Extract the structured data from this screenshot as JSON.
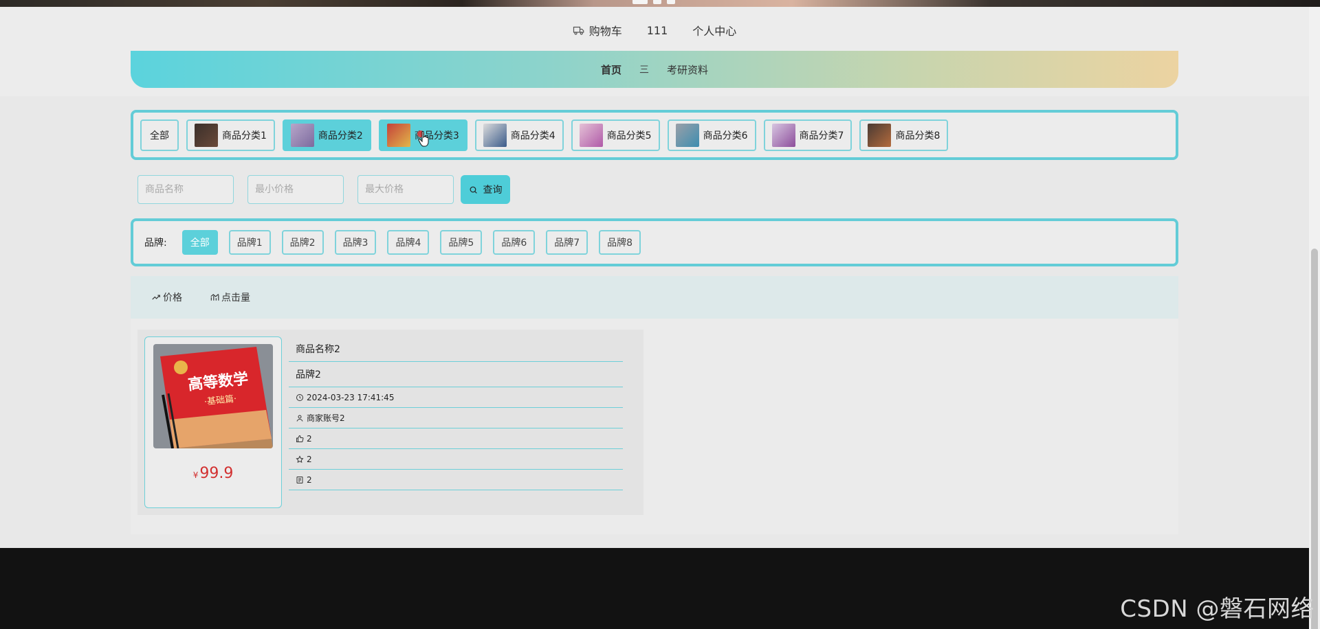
{
  "topnav": {
    "cart_label": "购物车",
    "user_name": "111",
    "profile_label": "个人中心"
  },
  "menubar": {
    "home_label": "首页",
    "separator": "三",
    "link_label": "考研资料"
  },
  "categories": {
    "all_label": "全部",
    "items": [
      {
        "label": "商品分类1",
        "active": false
      },
      {
        "label": "商品分类2",
        "active": true
      },
      {
        "label": "商品分类3",
        "active": true
      },
      {
        "label": "商品分类4",
        "active": false
      },
      {
        "label": "商品分类5",
        "active": false
      },
      {
        "label": "商品分类6",
        "active": false
      },
      {
        "label": "商品分类7",
        "active": false
      },
      {
        "label": "商品分类8",
        "active": false
      }
    ]
  },
  "search": {
    "name_placeholder": "商品名称",
    "min_price_placeholder": "最小价格",
    "max_price_placeholder": "最大价格",
    "button_label": "查询"
  },
  "brands": {
    "label": "品牌:",
    "all_label": "全部",
    "items": [
      "品牌1",
      "品牌2",
      "品牌3",
      "品牌4",
      "品牌5",
      "品牌6",
      "品牌7",
      "品牌8"
    ]
  },
  "sort": {
    "price_label": "价格",
    "clicks_label": "点击量"
  },
  "product": {
    "name": "商品名称2",
    "brand": "品牌2",
    "datetime": "2024-03-23 17:41:45",
    "seller": "商家账号2",
    "likes": "2",
    "favorites": "2",
    "comments": "2",
    "currency": "¥",
    "price": "99.9",
    "book_title_line1": "高等数学",
    "book_title_line2": "·基础篇·"
  },
  "watermark": "CSDN @磐石网络",
  "colors": {
    "accent": "#5cd0da",
    "price": "#d23030",
    "footer": "#121212"
  }
}
